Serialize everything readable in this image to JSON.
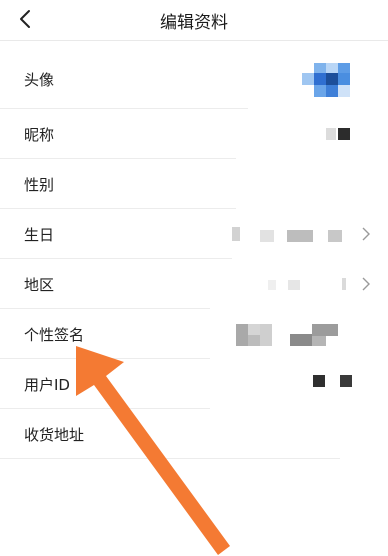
{
  "header": {
    "title": "编辑资料"
  },
  "icons": {
    "back": "chevron-left-icon",
    "row_arrow": "chevron-right-icon"
  },
  "rows": [
    {
      "label": "头像"
    },
    {
      "label": "昵称"
    },
    {
      "label": "性别"
    },
    {
      "label": "生日"
    },
    {
      "label": "地区"
    },
    {
      "label": "个性签名"
    },
    {
      "label": "用户ID"
    },
    {
      "label": "收货地址"
    }
  ],
  "annotation": {
    "arrow_color": "#f47a33",
    "target": "个性签名"
  },
  "colors": {
    "accent": "#f47a33",
    "avatar_blue": "#4a8ee0"
  }
}
